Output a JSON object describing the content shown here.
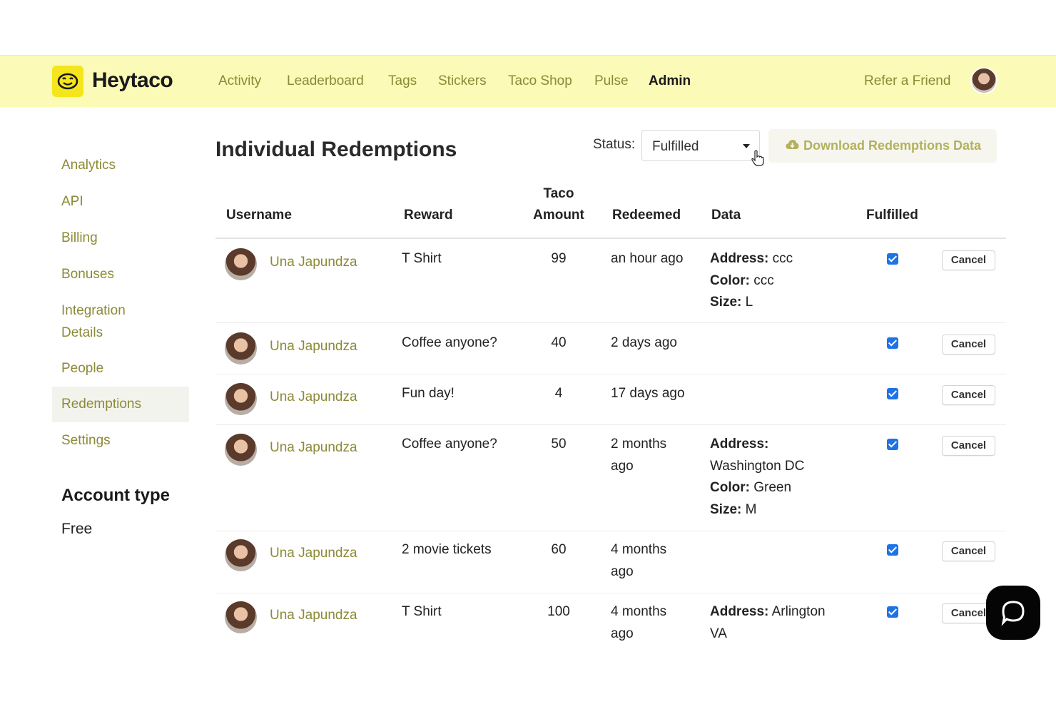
{
  "brand": {
    "name": "Heytaco"
  },
  "nav": {
    "links": [
      "Activity",
      "Leaderboard",
      "Tags",
      "Stickers",
      "Taco Shop",
      "Pulse",
      "Admin"
    ],
    "active": "Admin",
    "refer": "Refer a Friend"
  },
  "sidebar": {
    "items": [
      "Analytics",
      "API",
      "Billing",
      "Bonuses",
      "Integration Details",
      "People",
      "Redemptions",
      "Settings"
    ],
    "active": "Redemptions",
    "account_type_title": "Account type",
    "account_type_value": "Free"
  },
  "main": {
    "title": "Individual Redemptions",
    "status_label": "Status:",
    "status_value": "Fulfilled",
    "download_label": "Download Redemptions Data"
  },
  "table": {
    "headers": {
      "username": "Username",
      "reward": "Reward",
      "amount_line1": "Taco",
      "amount_line2": "Amount",
      "redeemed": "Redeemed",
      "data": "Data",
      "fulfilled": "Fulfilled"
    },
    "cancel_label": "Cancel",
    "rows": [
      {
        "user": "Una Japundza",
        "reward": "T Shirt",
        "amount": "99",
        "redeemed": [
          "an hour ago"
        ],
        "data": [
          [
            "Address:",
            "ccc"
          ],
          [
            "Color:",
            "ccc"
          ],
          [
            "Size:",
            "L"
          ]
        ],
        "fulfilled": true
      },
      {
        "user": "Una Japundza",
        "reward": "Coffee anyone?",
        "amount": "40",
        "redeemed": [
          "2 days ago"
        ],
        "data": [],
        "fulfilled": true
      },
      {
        "user": "Una Japundza",
        "reward": "Fun day!",
        "amount": "4",
        "redeemed": [
          "17 days ago"
        ],
        "data": [],
        "fulfilled": true
      },
      {
        "user": "Una Japundza",
        "reward": "Coffee anyone?",
        "amount": "50",
        "redeemed": [
          "2 months",
          "ago"
        ],
        "data": [
          [
            "Address:",
            ""
          ],
          [
            "",
            "Washington DC"
          ],
          [
            "Color:",
            "Green"
          ],
          [
            "Size:",
            "M"
          ]
        ],
        "fulfilled": true
      },
      {
        "user": "Una Japundza",
        "reward": "2 movie tickets",
        "amount": "60",
        "redeemed": [
          "4 months",
          "ago"
        ],
        "data": [],
        "fulfilled": true
      },
      {
        "user": "Una Japundza",
        "reward": "T Shirt",
        "amount": "100",
        "redeemed": [
          "4 months",
          "ago"
        ],
        "data": [
          [
            "Address:",
            "Arlington"
          ],
          [
            "",
            "VA"
          ]
        ],
        "fulfilled": true
      }
    ]
  },
  "colors": {
    "topbar": "#fbfab6",
    "accent": "#8c8a36",
    "checkbox": "#1e73e8",
    "logo": "#f5e51c"
  },
  "icons": [
    "taco-logo-icon",
    "cloud-download-icon",
    "pointer-cursor-icon",
    "chevron-down-icon",
    "chat-icon"
  ]
}
